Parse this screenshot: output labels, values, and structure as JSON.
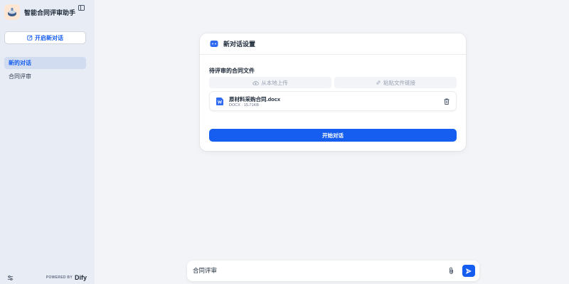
{
  "app": {
    "title": "智能合同评审助手"
  },
  "sidebar": {
    "new_chat_label": "开启新对话",
    "conversations": [
      {
        "label": "新的对话",
        "active": true
      },
      {
        "label": "合同评审",
        "active": false
      }
    ],
    "powered_by_label": "POWERED BY",
    "brand": "Dify"
  },
  "settings_card": {
    "title": "新对话设置",
    "section_label": "待评审的合同文件",
    "upload_local_label": "从本地上传",
    "paste_link_label": "粘贴文件链接",
    "file": {
      "name": "原材料采购合同.docx",
      "meta": "DOCX · 15.71KB"
    },
    "start_label": "开始对话"
  },
  "chat_input": {
    "value": "合同评审"
  },
  "colors": {
    "accent": "#155eef",
    "sidebar_bg": "#e8ecf4",
    "main_bg": "#f2f4f7"
  },
  "icons": {
    "collapse": "sidebar-collapse-icon",
    "new_chat": "edit-icon",
    "settings": "settings-icon",
    "card_header": "chat-bubble-icon",
    "upload": "cloud-upload-icon",
    "link": "link-icon",
    "file": "word-document-icon",
    "delete": "trash-icon",
    "attach": "paperclip-icon",
    "send": "send-icon"
  }
}
